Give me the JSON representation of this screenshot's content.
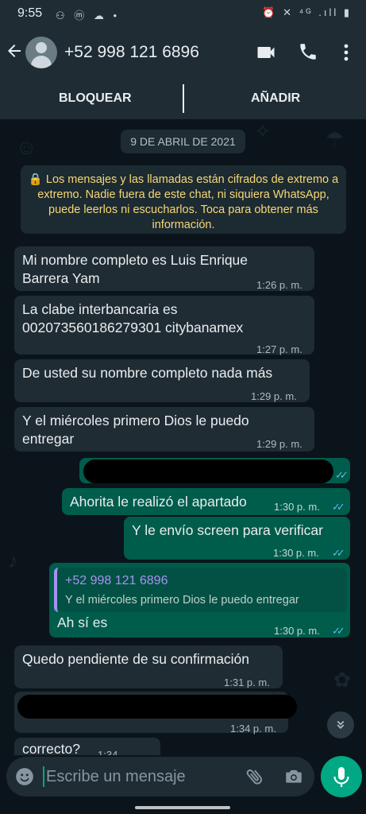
{
  "status_bar": {
    "time": "9:55",
    "left_icons": "⚇ ⓜ ☁ •",
    "right_icons": "⏰ ✕ ⁴ᴳ .ıll ▮"
  },
  "header": {
    "back_icon": "arrow-left-icon",
    "contact_name": "+52 998 121 6896"
  },
  "action_bar": {
    "block_label": "BLOQUEAR",
    "add_label": "AÑADIR"
  },
  "chat": {
    "date": "9 DE ABRIL DE 2021",
    "encryption_notice": "🔒 Los mensajes y las llamadas están cifrados de extremo a extremo. Nadie fuera de este chat, ni siquiera WhatsApp, puede leerlos ni escucharlos. Toca para obtener más información.",
    "messages": [
      {
        "text": "Mi nombre completo es Luis Enrique Barrera Yam",
        "time": "1:26 p. m."
      },
      {
        "text": "La clabe interbancaria es 002073560186279301 citybanamex",
        "time": "1:27 p. m."
      },
      {
        "text": "De usted su nombre completo nada más",
        "time": "1:29 p. m."
      },
      {
        "text": "Y el miércoles primero Dios le puedo entregar",
        "time": "1:29 p. m."
      },
      {
        "text": "Ahorita le realizó el apartado",
        "time": "1:30 p. m."
      },
      {
        "text": "Y le envío screen para verificar",
        "time": "1:30 p. m."
      },
      {
        "text": "Ah sí es",
        "time": "1:30 p. m.",
        "quote_author": "+52 998 121 6896",
        "quote_text": "Y el miércoles primero Dios le puedo entregar"
      },
      {
        "text": "Quedo pendiente de su confirmación",
        "time": "1:31 p. m."
      },
      {
        "text": "",
        "time": "1:34 p. m."
      },
      {
        "text": "correcto?",
        "time": "1:34"
      }
    ],
    "read_ticks": "✓✓"
  },
  "input": {
    "placeholder": "Escribe un mensaje"
  },
  "colors": {
    "accent": "#00a884",
    "outgoing": "#005c4b",
    "incoming": "#202c33",
    "header": "#1f2c34",
    "read_tick": "#53bdeb"
  }
}
